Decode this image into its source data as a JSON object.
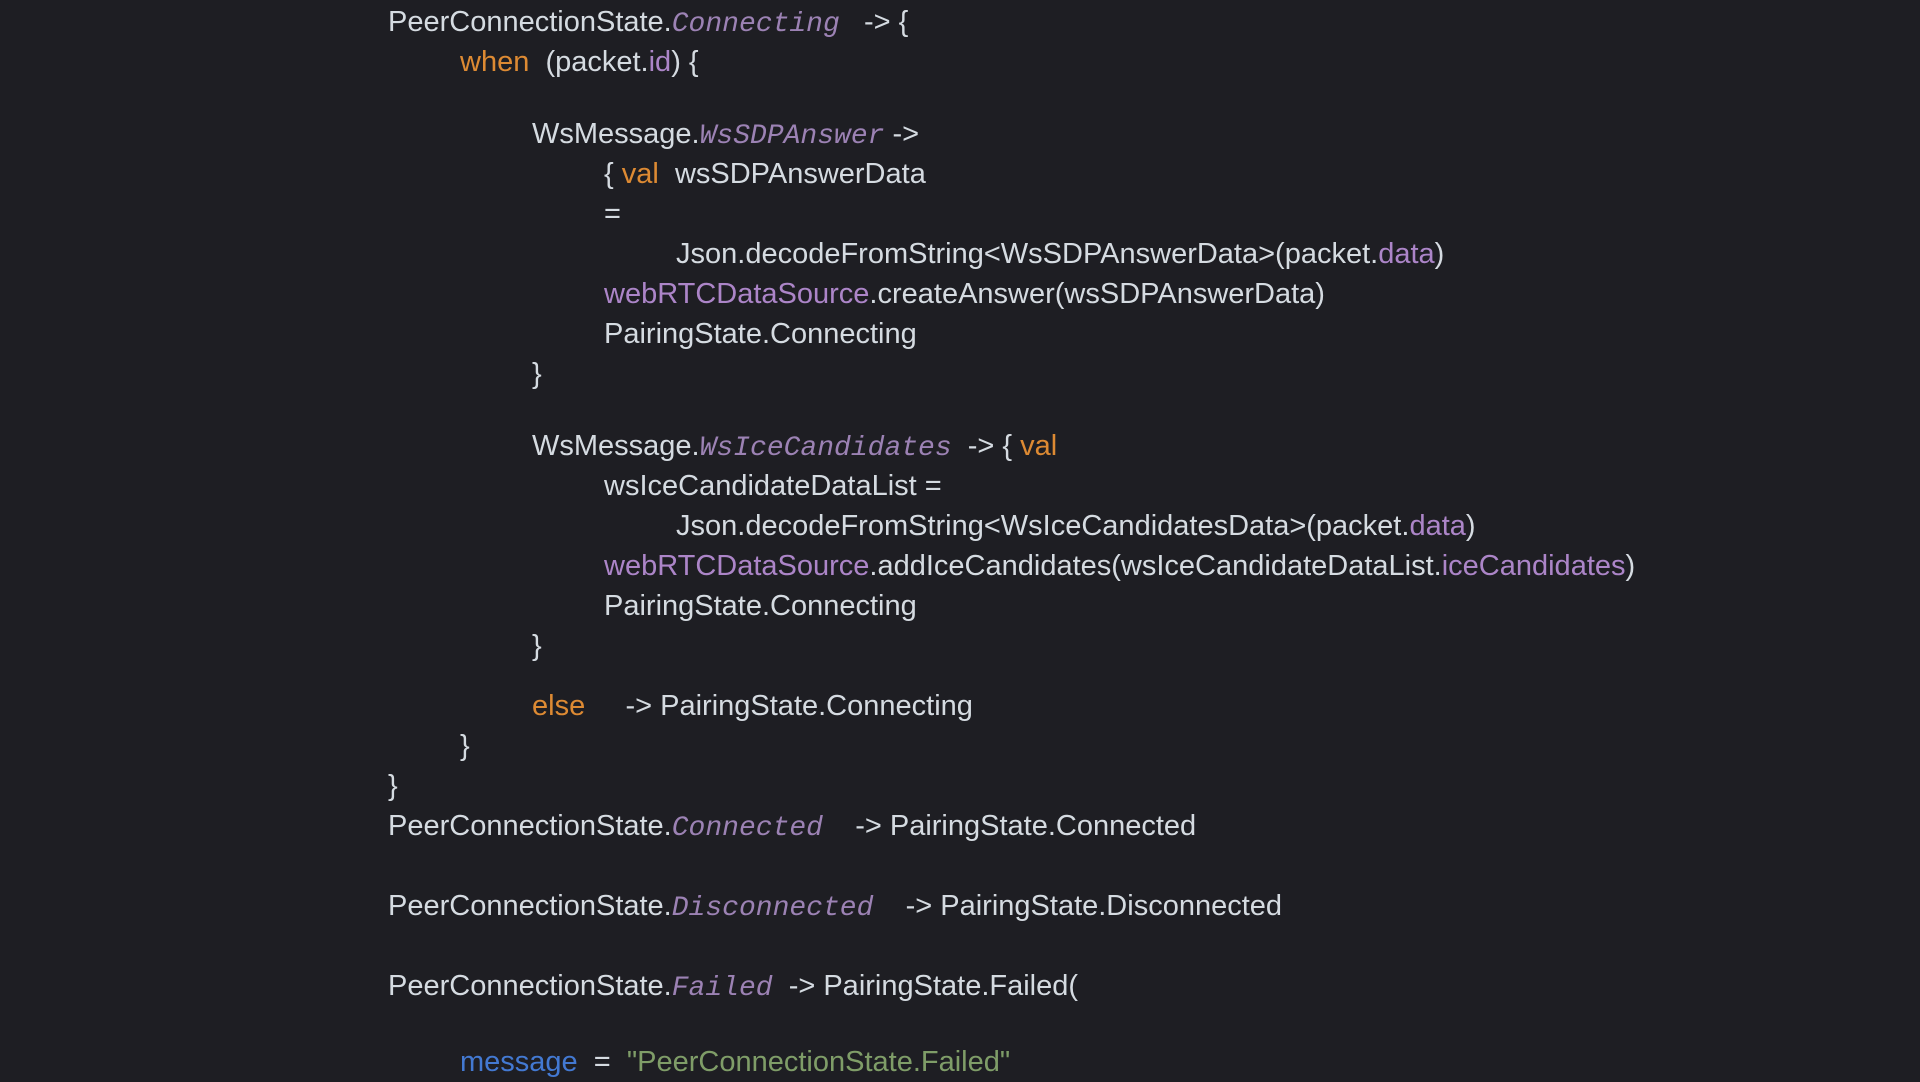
{
  "colors": {
    "background": "#1e1e23",
    "plain_text": "#d5dbe1",
    "keyword": "#dd8a33",
    "enum_case": "#9c82b4",
    "property": "#ac85c8",
    "declaration": "#4379d2",
    "string": "#7f9d68"
  },
  "code": {
    "lines": [
      {
        "indent": 0,
        "gap": 0,
        "tokens": [
          {
            "t": "plain",
            "v": "PeerConnectionState."
          },
          {
            "t": "enum",
            "v": "Connecting"
          },
          {
            "t": "plain",
            "v": "   -> {"
          }
        ]
      },
      {
        "indent": 1,
        "gap": 0,
        "tokens": [
          {
            "t": "kw",
            "v": "when"
          },
          {
            "t": "plain",
            "v": "  (packet."
          },
          {
            "t": "prop",
            "v": "id"
          },
          {
            "t": "plain",
            "v": ") {"
          }
        ]
      },
      {
        "indent": 2,
        "gap": 32,
        "tokens": [
          {
            "t": "plain",
            "v": "WsMessage."
          },
          {
            "t": "enum",
            "v": "WsSDPAnswer"
          },
          {
            "t": "plain",
            "v": " ->"
          }
        ]
      },
      {
        "indent": 3,
        "gap": 0,
        "tokens": [
          {
            "t": "plain",
            "v": "{ "
          },
          {
            "t": "kw",
            "v": "val"
          },
          {
            "t": "plain",
            "v": "  wsSDPAnswerData"
          }
        ]
      },
      {
        "indent": 3,
        "gap": 0,
        "tokens": [
          {
            "t": "plain",
            "v": "="
          }
        ]
      },
      {
        "indent": 4,
        "gap": 0,
        "tokens": [
          {
            "t": "plain",
            "v": "Json.decodeFromString<WsSDPAnswerData>(packet."
          },
          {
            "t": "prop",
            "v": "data"
          },
          {
            "t": "plain",
            "v": ")"
          }
        ]
      },
      {
        "indent": 3,
        "gap": 0,
        "tokens": [
          {
            "t": "prop",
            "v": "webRTCDataSource"
          },
          {
            "t": "plain",
            "v": ".createAnswer(wsSDPAnswerData)"
          }
        ]
      },
      {
        "indent": 3,
        "gap": 0,
        "tokens": [
          {
            "t": "plain",
            "v": "PairingState.Connecting"
          }
        ]
      },
      {
        "indent": 2,
        "gap": 0,
        "tokens": [
          {
            "t": "plain",
            "v": "}"
          }
        ]
      },
      {
        "indent": 2,
        "gap": 32,
        "tokens": [
          {
            "t": "plain",
            "v": "WsMessage."
          },
          {
            "t": "enum",
            "v": "WsIceCandidates"
          },
          {
            "t": "plain",
            "v": "  -> { "
          },
          {
            "t": "kw",
            "v": "val"
          }
        ]
      },
      {
        "indent": 3,
        "gap": 0,
        "tokens": [
          {
            "t": "plain",
            "v": "wsIceCandidateDataList ="
          }
        ]
      },
      {
        "indent": 4,
        "gap": 0,
        "tokens": [
          {
            "t": "plain",
            "v": "Json.decodeFromString<WsIceCandidatesData>(packet."
          },
          {
            "t": "prop",
            "v": "data"
          },
          {
            "t": "plain",
            "v": ")"
          }
        ]
      },
      {
        "indent": 3,
        "gap": 0,
        "tokens": [
          {
            "t": "prop",
            "v": "webRTCDataSource"
          },
          {
            "t": "plain",
            "v": ".addIceCandidates(wsIceCandidateDataList."
          },
          {
            "t": "prop",
            "v": "iceCandidates"
          },
          {
            "t": "plain",
            "v": ")"
          }
        ]
      },
      {
        "indent": 3,
        "gap": 0,
        "tokens": [
          {
            "t": "plain",
            "v": "PairingState.Connecting"
          }
        ]
      },
      {
        "indent": 2,
        "gap": 0,
        "tokens": [
          {
            "t": "plain",
            "v": "}"
          }
        ]
      },
      {
        "indent": 2,
        "gap": 20,
        "tokens": [
          {
            "t": "kw",
            "v": "else"
          },
          {
            "t": "plain",
            "v": "     -> PairingState.Connecting"
          }
        ]
      },
      {
        "indent": 1,
        "gap": 0,
        "tokens": [
          {
            "t": "plain",
            "v": "}"
          }
        ]
      },
      {
        "indent": 0,
        "gap": 0,
        "tokens": [
          {
            "t": "plain",
            "v": "}"
          }
        ]
      },
      {
        "indent": 0,
        "gap": 0,
        "tokens": [
          {
            "t": "plain",
            "v": "PeerConnectionState."
          },
          {
            "t": "enum",
            "v": "Connected"
          },
          {
            "t": "plain",
            "v": "    -> PairingState.Connected"
          }
        ]
      },
      {
        "indent": 0,
        "gap": 40,
        "tokens": [
          {
            "t": "plain",
            "v": "PeerConnectionState."
          },
          {
            "t": "enum",
            "v": "Disconnected"
          },
          {
            "t": "plain",
            "v": "    -> PairingState.Disconnected"
          }
        ]
      },
      {
        "indent": 0,
        "gap": 40,
        "tokens": [
          {
            "t": "plain",
            "v": "PeerConnectionState."
          },
          {
            "t": "enum",
            "v": "Failed"
          },
          {
            "t": "plain",
            "v": "  -> PairingState.Failed("
          }
        ]
      },
      {
        "indent": 1,
        "gap": 36,
        "tokens": [
          {
            "t": "decl",
            "v": "message"
          },
          {
            "t": "plain",
            "v": "  =  "
          },
          {
            "t": "str",
            "v": "\"PeerConnectionState.Failed\""
          }
        ]
      }
    ]
  }
}
